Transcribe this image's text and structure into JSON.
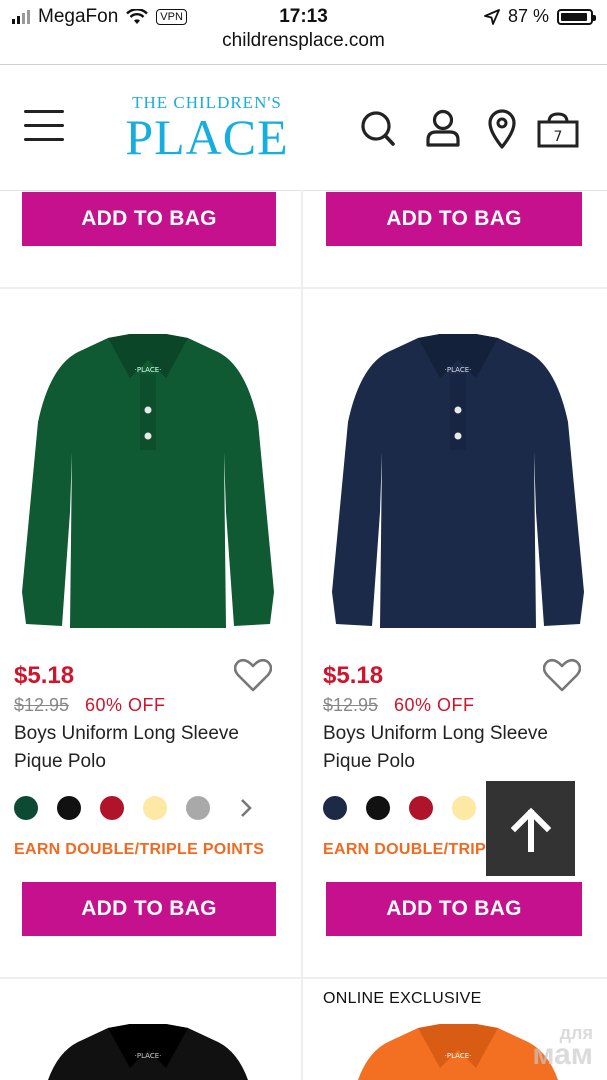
{
  "status_bar": {
    "carrier": "MegaFon",
    "vpn": "VPN",
    "time": "17:13",
    "battery": "87 %",
    "url": "childrensplace.com"
  },
  "header": {
    "logo_top": "THE CHILDREN'S",
    "logo_main": "PLACE",
    "bag_count": "7"
  },
  "add_to_bag_label": "ADD TO BAG",
  "products": [
    {
      "price": "$5.18",
      "was_price": "$12.95",
      "discount": "60% OFF",
      "name": "Boys Uniform Long Sleeve Pique Polo",
      "shirt_color": "#0f5a32",
      "swatches": [
        "#0d4a33",
        "#111111",
        "#b0142a",
        "#fde9a3",
        "#a9a9a9"
      ],
      "earn": "EARN DOUBLE/TRIPLE POINTS"
    },
    {
      "price": "$5.18",
      "was_price": "$12.95",
      "discount": "60% OFF",
      "name": "Boys Uniform Long Sleeve Pique Polo",
      "shirt_color": "#1a2a48",
      "swatches": [
        "#1c2a46",
        "#111111",
        "#b0142a",
        "#fde9a3"
      ],
      "earn": "EARN DOUBLE/TRIPLE POINTS"
    }
  ],
  "next_row": {
    "online_exclusive": "ONLINE EXCLUSIVE",
    "left_shirt_color": "#111111",
    "right_shirt_color": "#f36f21"
  },
  "watermark": {
    "top": "для",
    "bottom": "мам"
  },
  "colors": {
    "brand": "#16aee0",
    "button": "#c5118e",
    "sale": "#d0142c",
    "earn": "#f26a21"
  }
}
